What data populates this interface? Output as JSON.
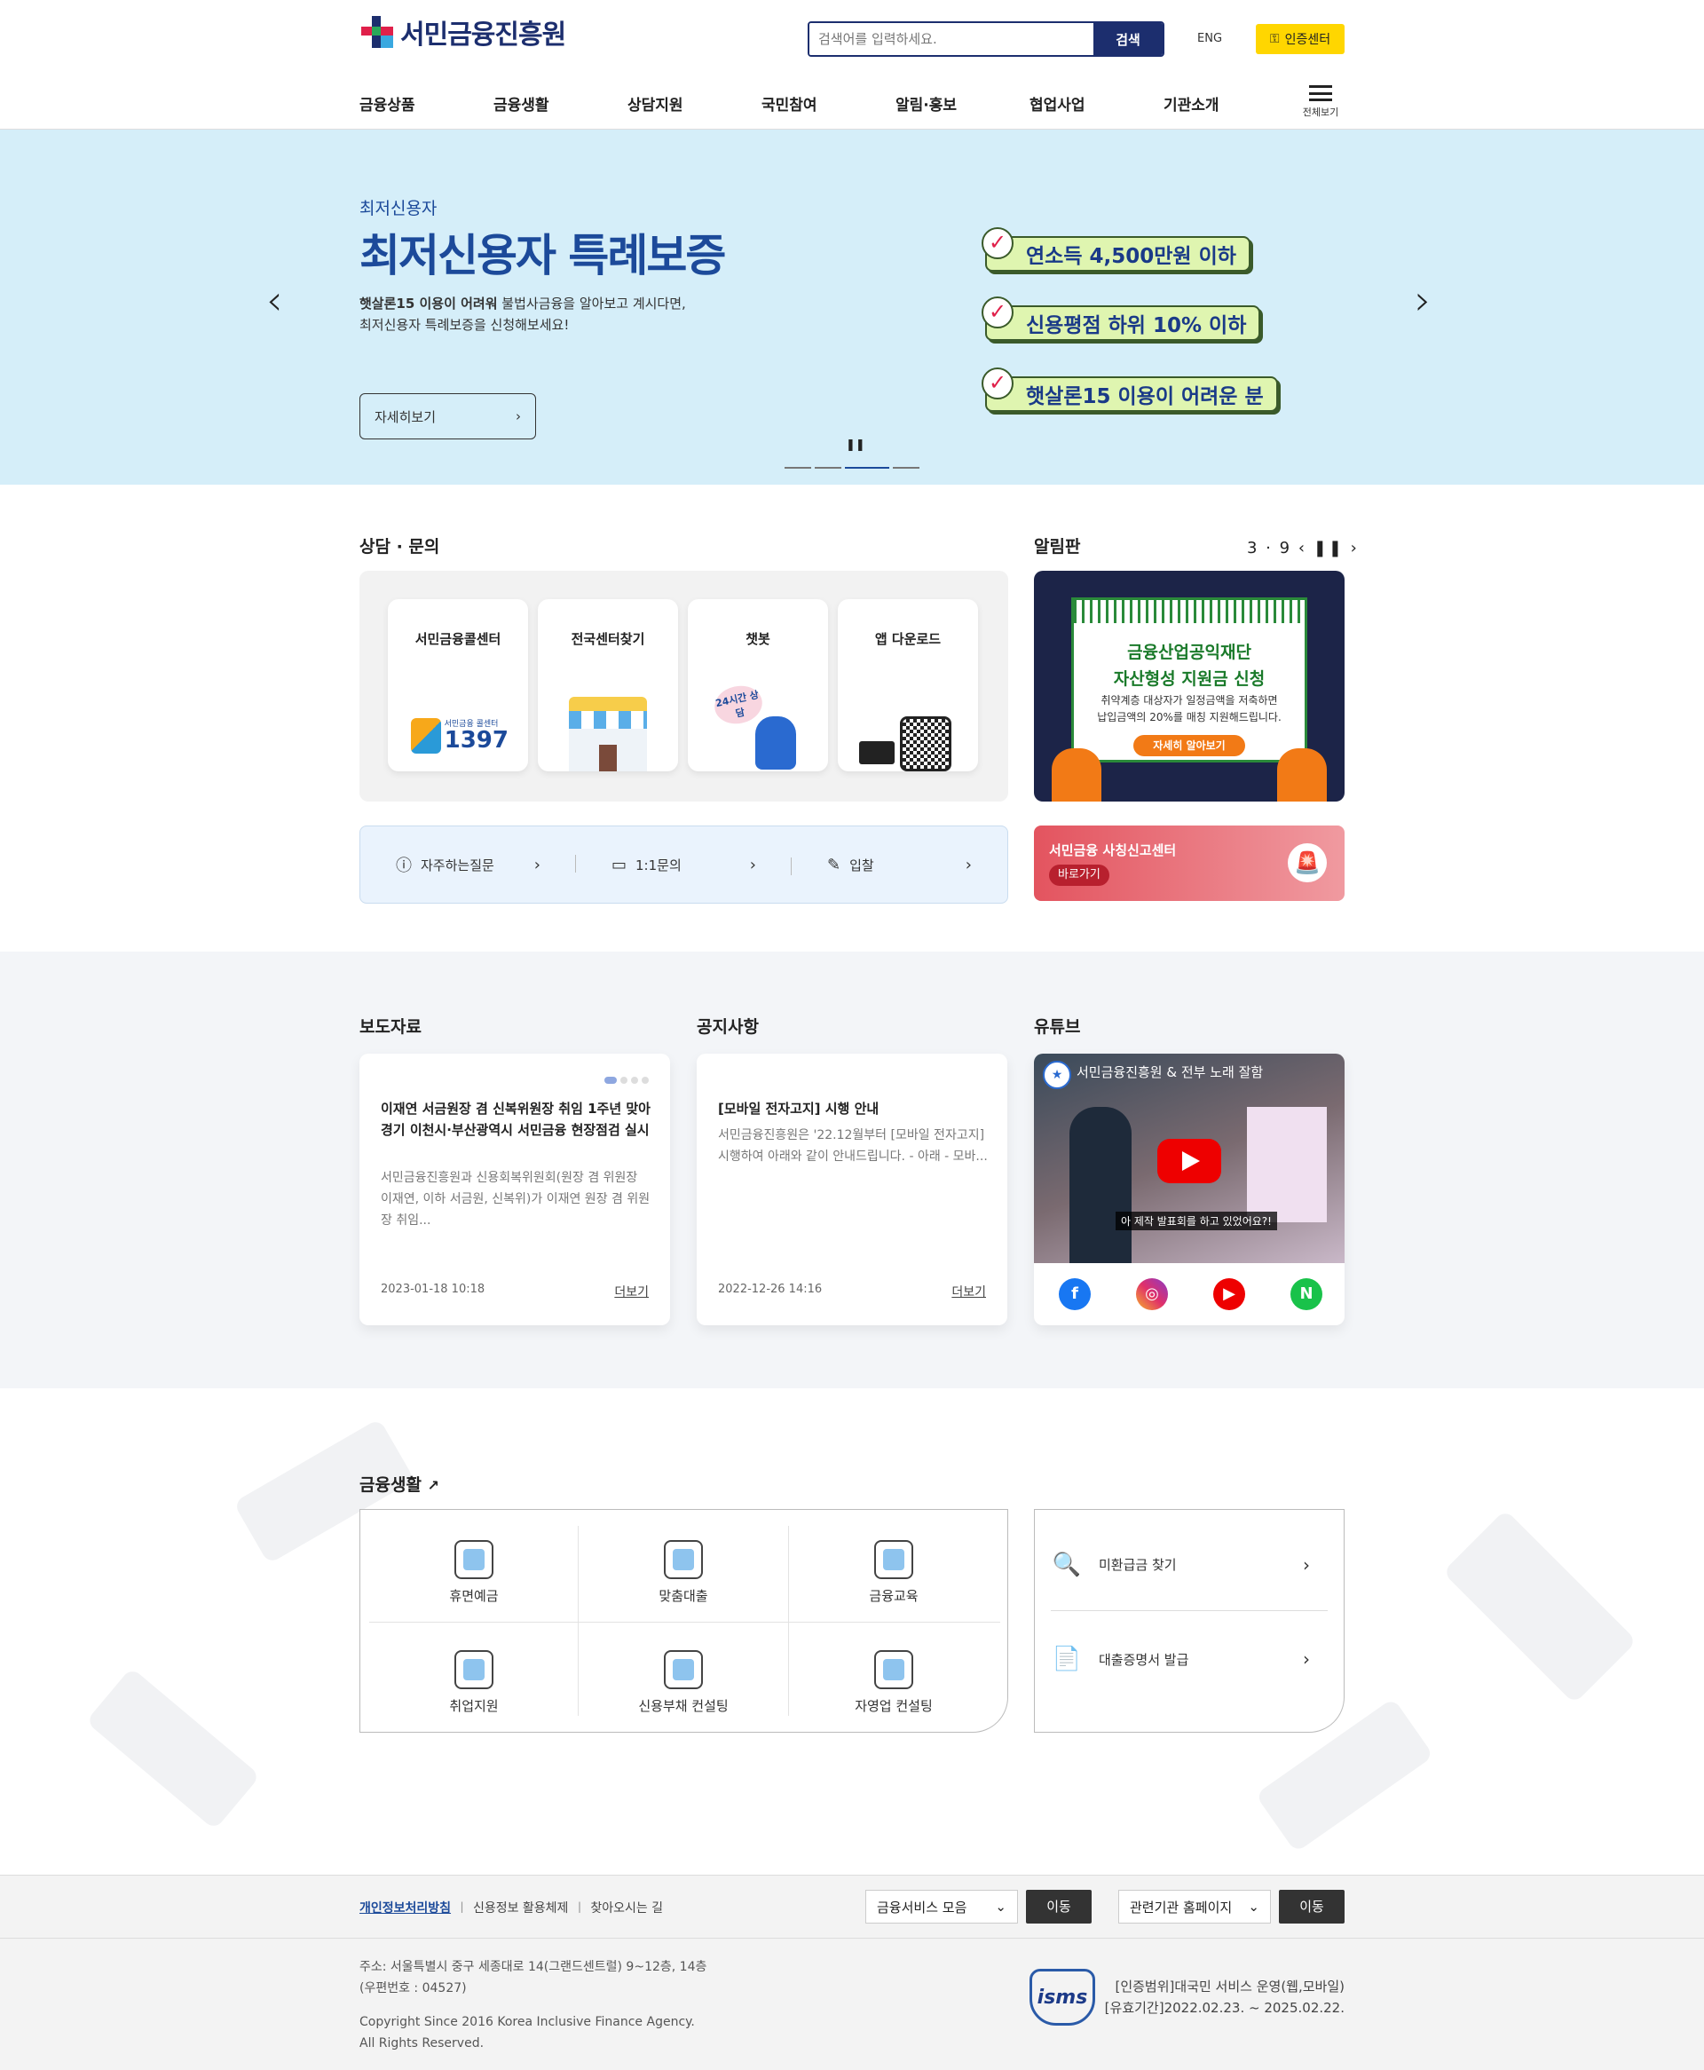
{
  "header": {
    "logo_text": "서민금융진흥원",
    "search_placeholder": "검색어를 입력하세요.",
    "search_button": "검색",
    "lang": "ENG",
    "cert_label": "인증센터",
    "nav": [
      "금융상품",
      "금융생활",
      "상담지원",
      "국민참여",
      "알림·홍보",
      "협업사업",
      "기관소개"
    ],
    "all_menu": "전체보기"
  },
  "hero": {
    "subtitle": "최저신용자",
    "title": "최저신용자 특례보증",
    "desc_bold": "햇살론15 이용이 어려워",
    "desc_rest": " 불법사금융을 알아보고 계시다면,",
    "desc_line2": "최저신용자 특례보증을 신청해보세요!",
    "more_label": "자세히보기",
    "pills": [
      "연소득 4,500만원 이하",
      "신용평점 하위 10% 이하",
      "햇살론15 이용이 어려운 분"
    ],
    "slide_count": 4,
    "active_slide": 3
  },
  "consult": {
    "title": "상담 · 문의",
    "cards": [
      "서민금융콜센터",
      "전국센터찾기",
      "챗봇",
      "앱 다운로드"
    ],
    "callcenter_small": "서민금융 콜센터",
    "callcenter_number": "1397",
    "chatbot_badge": "24시간 상담",
    "quick": [
      "자주하는질문",
      "1:1문의",
      "입찰"
    ]
  },
  "noticeboard": {
    "title": "알림판",
    "counter": "3 · 9",
    "board_title_1": "금융산업공익재단",
    "board_title_2": "자산형성 지원금 신청",
    "board_desc_1": "취약계층 대상자가 일정금액을 저축하면",
    "board_desc_2": "납입금액의 20%를 매칭 지원해드립니다.",
    "board_btn": "자세히 알아보기"
  },
  "report": {
    "title": "서민금융 사칭신고센터",
    "button": "바로가기"
  },
  "news": {
    "press_title": "보도자료",
    "press_headline": "이재연 서금원장 겸 신복위원장 취임 1주년 맞아 경기 이천시·부산광역시 서민금융 현장점검 실시",
    "press_desc": "서민금융진흥원과 신용회복위원회(원장 겸 위원장 이재연, 이하 서금원, 신복위)가 이재연 원장 겸 위원장 취임...",
    "press_date": "2023-01-18 10:18",
    "notice_title": "공지사항",
    "notice_headline": "[모바일 전자고지] 시행 안내",
    "notice_desc": "서민금융진흥원은 '22.12월부터 [모바일 전자고지] 시행하여 아래와 같이 안내드립니다. - 아래 - 모바...",
    "notice_date": "2022-12-26 14:16",
    "more": "더보기",
    "youtube_title": "유튜브",
    "video_title": "서민금융진흥원 & 전부 노래 잘함",
    "video_caption": "아 제작 발표회를 하고 있었어요?!"
  },
  "life": {
    "title": "금융생활",
    "items": [
      "휴면예금",
      "맞춤대출",
      "금융교육",
      "취업지원",
      "신용부채 컨설팅",
      "자영업 컨설팅"
    ],
    "side": [
      "미환급금 찾기",
      "대출증명서 발급"
    ]
  },
  "footer": {
    "privacy": "개인정보처리방침",
    "credit": "신용정보 활용체제",
    "directions": "찾아오시는 길",
    "select1": "금융서비스 모음",
    "select2": "관련기관 홈페이지",
    "go": "이동",
    "address_1": "주소: 서울특별시 중구 세종대로 14(그랜드센트럴) 9~12층, 14층",
    "address_2": "(우편번호 : 04527)",
    "copyright_1": "Copyright Since 2016 Korea Inclusive Finance Agency.",
    "copyright_2": "All Rights Reserved.",
    "isms": "isms",
    "cert_1": "[인증범위]대국민 서비스 운영(웹,모바일)",
    "cert_2": "[유효기간]2022.02.23. ~ 2025.02.22."
  },
  "colors": {
    "brand_navy": "#1c2e6e",
    "hero_bg": "#d5eef9",
    "cert_yellow": "#ffd600",
    "report_red": "#e3545f"
  }
}
